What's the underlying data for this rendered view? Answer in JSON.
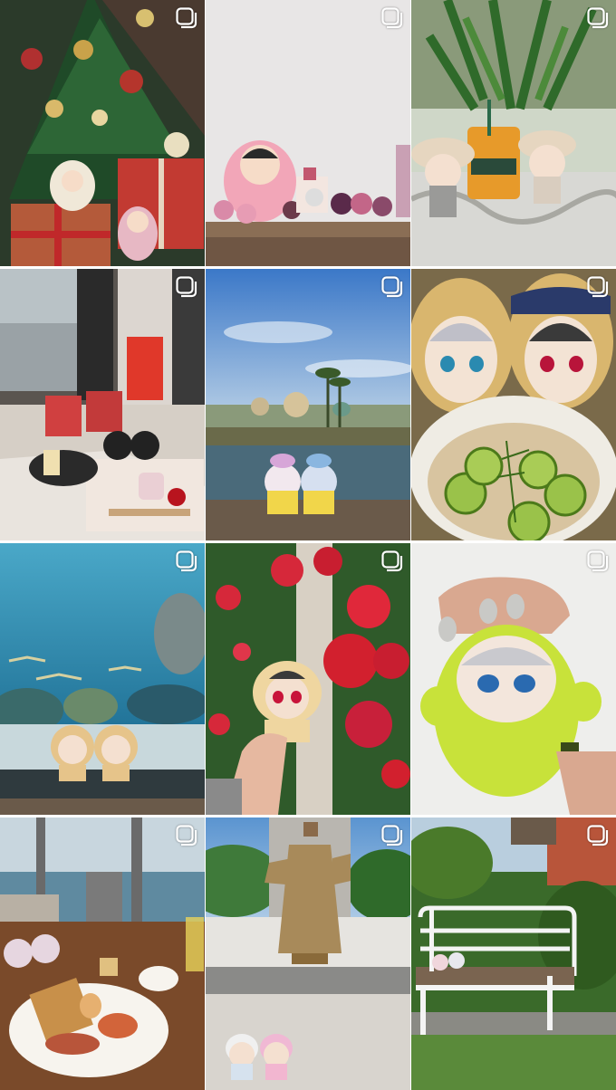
{
  "grid": {
    "columns": 3,
    "posts": [
      {
        "scene": "christmas-tree-gifts",
        "multi_icon": "carousel-icon"
      },
      {
        "scene": "plush-shelf-display",
        "multi_icon": "carousel-icon"
      },
      {
        "scene": "cafe-drink-plushies",
        "multi_icon": "carousel-icon"
      },
      {
        "scene": "window-dessert-table",
        "multi_icon": "carousel-icon"
      },
      {
        "scene": "theme-park-lagoon",
        "multi_icon": "carousel-icon"
      },
      {
        "scene": "plush-ramen-bowl",
        "multi_icon": "carousel-icon"
      },
      {
        "scene": "aquarium-tank",
        "multi_icon": "carousel-icon"
      },
      {
        "scene": "red-flowers-plush",
        "multi_icon": "carousel-icon"
      },
      {
        "scene": "green-fluffy-plush",
        "multi_icon": "carousel-icon"
      },
      {
        "scene": "seaside-breakfast",
        "multi_icon": "carousel-icon"
      },
      {
        "scene": "statue-plaza",
        "multi_icon": "carousel-icon"
      },
      {
        "scene": "garden-bench",
        "multi_icon": "carousel-icon"
      }
    ]
  },
  "colors": {
    "background": "#ffffff",
    "icon": "#ffffff"
  }
}
